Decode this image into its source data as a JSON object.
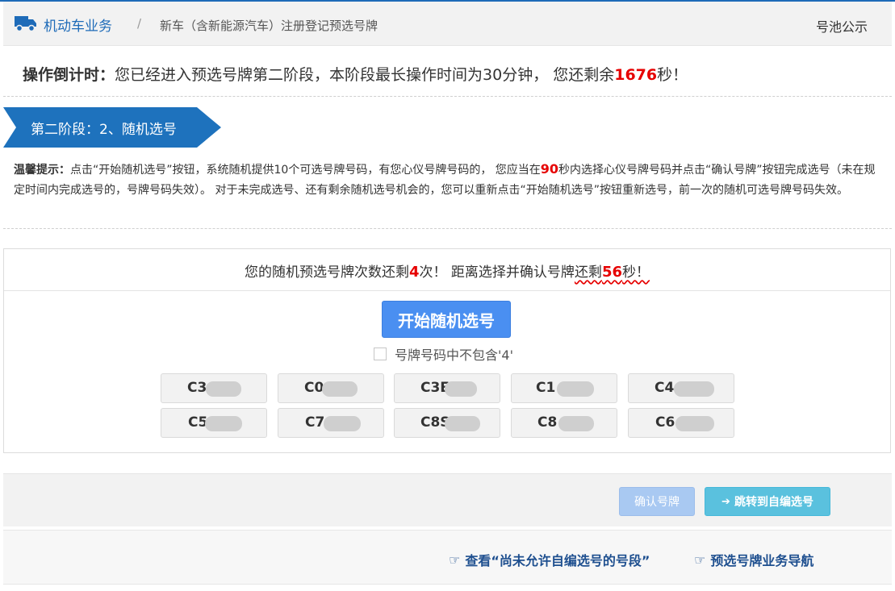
{
  "breadcrumb": {
    "module": "机动车业务",
    "separator": "/",
    "page": "新车（含新能源汽车）注册登记预选号牌",
    "right_link": "号池公示"
  },
  "countdown": {
    "label": "操作倒计时：",
    "text_before": "您已经进入预选号牌第二阶段，本阶段最长操作时间为30分钟， 您还剩余",
    "seconds": "1676",
    "text_after": "秒！"
  },
  "stage": {
    "label": "第二阶段：2、随机选号"
  },
  "tips": {
    "label": "温馨提示：",
    "text_before": "点击“开始随机选号”按钮，系统随机提供10个可选号牌号码，有您心仪号牌号码的， 您应当在",
    "seconds": "90",
    "text_after": "秒内选择心仪号牌号码并点击“确认号牌”按钮完成选号（未在规定时间内完成选号的，号牌号码失效）。 对于未完成选号、还有剩余随机选号机会的，您可以重新点击“开始随机选号”按钮重新选号，前一次的随机可选号牌号码失效。"
  },
  "selection": {
    "remain_prefix": "您的随机预选号牌次数还剩",
    "remain_count": "4",
    "remain_mid": "次！ 距离选择并确认号牌",
    "remain_underlined": "还剩",
    "remain_seconds": "56",
    "remain_suffix": "秒！",
    "start_button": "开始随机选号",
    "exclude_four_label": "号牌号码中不包含'4'",
    "exclude_four_checked": false,
    "plates": [
      "C3",
      "C0",
      "C3E",
      "C1",
      "C4",
      "C5",
      "C7",
      "C8S",
      "C8",
      "C6"
    ]
  },
  "actions": {
    "confirm_button": "确认号牌",
    "goto_button": "跳转到自编选号"
  },
  "links": {
    "segments_link": "查看“尚未允许自编选号的号段”",
    "nav_link": "预选号牌业务导航"
  },
  "colors": {
    "brand_blue": "#1e6bb8",
    "countdown_red": "#e60000",
    "start_button": "#4a8ff1",
    "confirm_disabled": "#a9c9f2",
    "goto_button": "#5ac1de"
  },
  "icons": {
    "module": "truck-icon",
    "goto": "arrow-right-icon",
    "links": "hand-pointer-icon"
  }
}
